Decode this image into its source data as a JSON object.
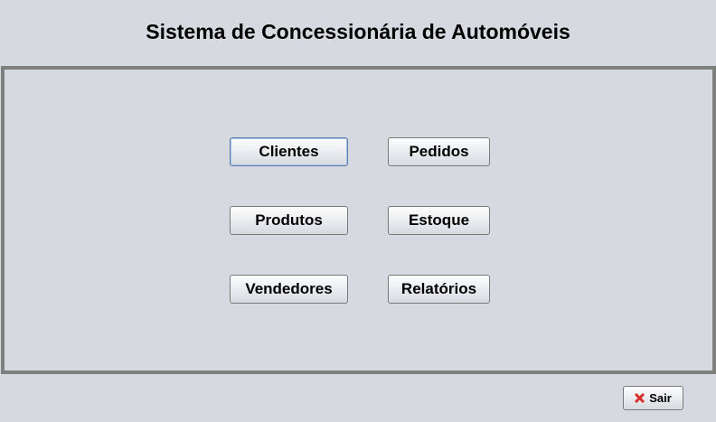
{
  "window": {
    "title": "Sistema de Concessionária de Automóveis"
  },
  "menu": {
    "clientes": "Clientes",
    "pedidos": "Pedidos",
    "produtos": "Produtos",
    "estoque": "Estoque",
    "vendedores": "Vendedores",
    "relatorios": "Relatórios"
  },
  "footer": {
    "exit_label": "Sair",
    "exit_icon": "close-icon"
  },
  "colors": {
    "background": "#d6d9df",
    "panel_border": "#7f7f7f",
    "focus_border": "#5b7fb0",
    "exit_icon": "#d8322d"
  }
}
